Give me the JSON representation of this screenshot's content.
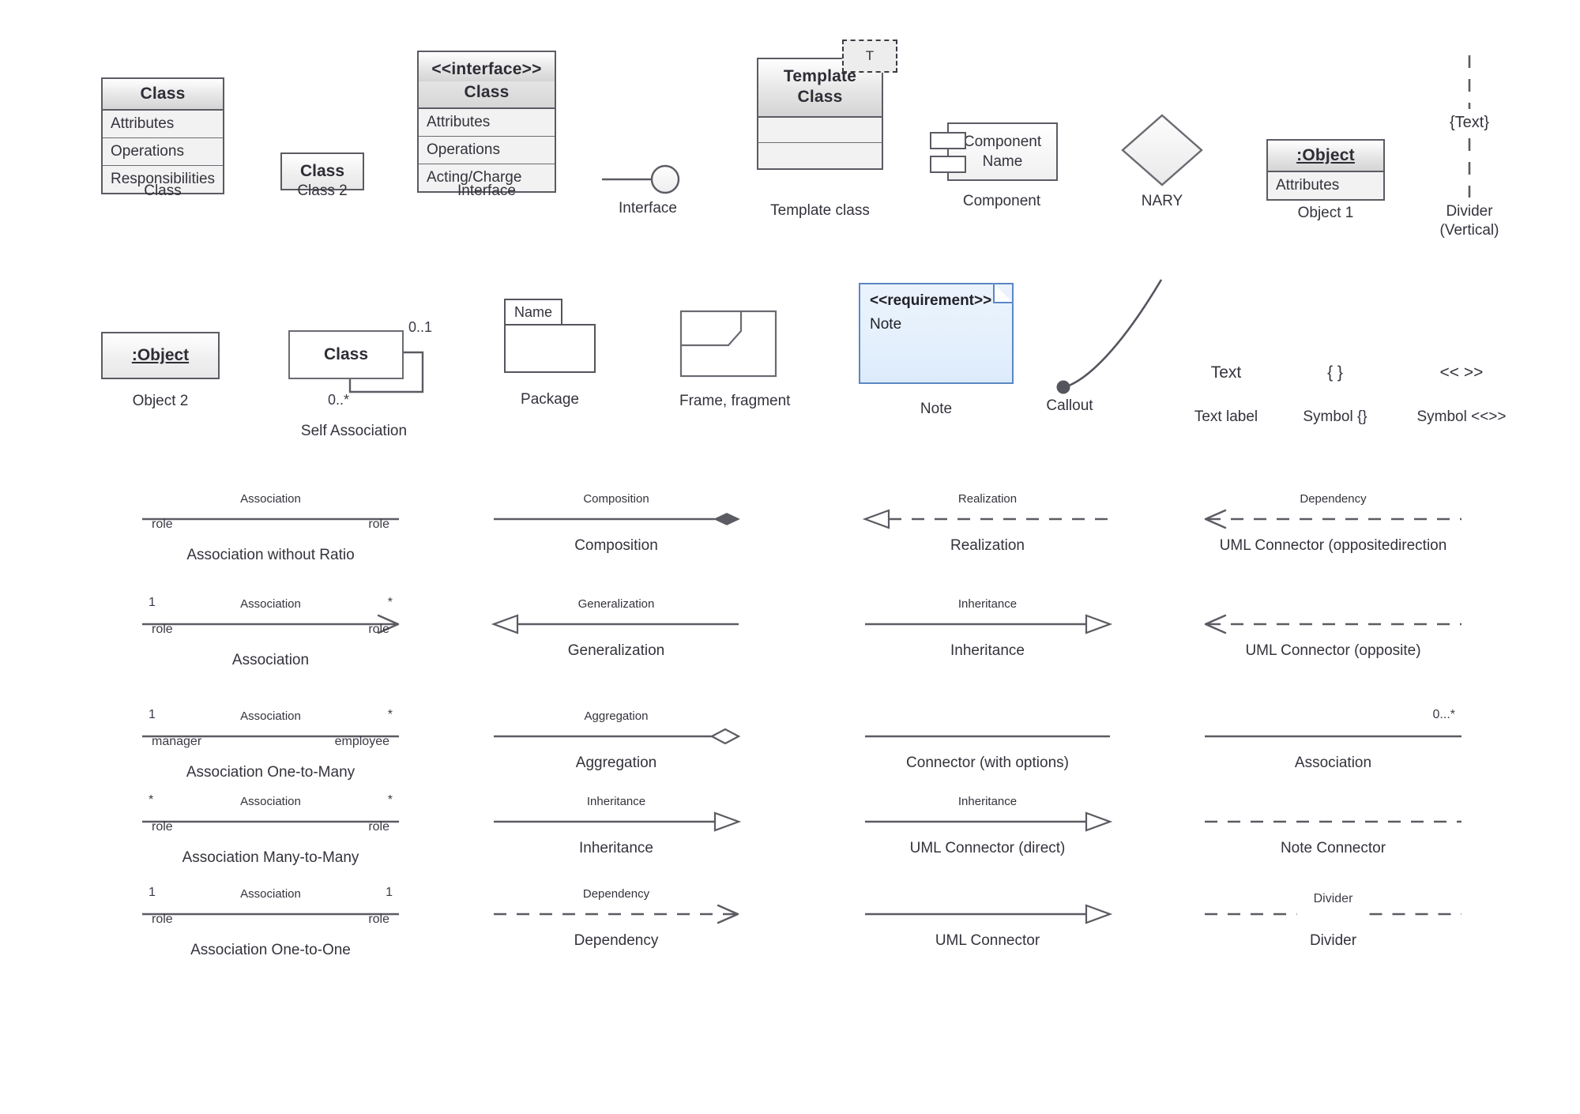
{
  "palette": {
    "stroke": "#5b5b63",
    "text": "#33333c",
    "note_border": "#5b87c6",
    "note_fill": "#e4f0fc",
    "header_gradient_top": "#ffffff",
    "header_gradient_bottom": "#d4d4d4",
    "body_fill": "#f2f2f2",
    "background": "#ffffff"
  },
  "shapes_row1": {
    "class_full": {
      "caption": "Class",
      "header": "Class",
      "rows": [
        "Attributes",
        "Operations",
        "Responsibilities"
      ]
    },
    "class2": {
      "caption": "Class 2",
      "label": "Class"
    },
    "interface_box": {
      "caption": "Interface",
      "stereotype": "<<interface>>",
      "header": "Class",
      "rows": [
        "Attributes",
        "Operations",
        "Acting/Charge"
      ]
    },
    "interface_lollipop": {
      "caption": "Interface"
    },
    "template_class": {
      "caption": "Template class",
      "header": "Template\nClass",
      "parameter": "T",
      "rows": [
        "",
        ""
      ]
    },
    "component": {
      "caption": "Component",
      "label": "Component\nName"
    },
    "nary": {
      "caption": "NARY"
    },
    "object1": {
      "caption": "Object 1",
      "header": ":Object",
      "rows": [
        "Attributes"
      ]
    },
    "divider_vertical": {
      "caption": "Divider\n(Vertical)",
      "label": "{Text}"
    }
  },
  "shapes_row2": {
    "object2": {
      "caption": "Object 2",
      "label": ":Object"
    },
    "self_association": {
      "caption": "Self Association",
      "label": "Class",
      "mult_top": "0..1",
      "mult_bottom": "0..*"
    },
    "package": {
      "caption": "Package",
      "tab_label": "Name"
    },
    "frame_fragment": {
      "caption": "Frame, fragment"
    },
    "note": {
      "caption": "Note",
      "stereotype": "<<requirement>>",
      "body": "Note"
    },
    "callout": {
      "caption": "Callout"
    },
    "text_label": {
      "caption": "Text label",
      "sample": "Text"
    },
    "symbol_braces": {
      "caption": "Symbol {}",
      "sample": "{ }"
    },
    "symbol_guillemets": {
      "caption": "Symbol <<>>",
      "sample": "<< >>"
    }
  },
  "connectors": [
    {
      "caption": "Association without Ratio",
      "edge_label": "Association",
      "mult_left": "",
      "mult_right": "",
      "role_left": "role",
      "role_right": "role",
      "style": "solid",
      "arrow": "none",
      "col": 0,
      "row": 0
    },
    {
      "caption": "Composition",
      "edge_label": "Composition",
      "mult_left": "",
      "mult_right": "",
      "role_left": "",
      "role_right": "",
      "style": "solid",
      "arrow": "filled-diamond-right",
      "col": 1,
      "row": 0
    },
    {
      "caption": "Realization",
      "edge_label": "Realization",
      "mult_left": "",
      "mult_right": "",
      "role_left": "",
      "role_right": "",
      "style": "dashed",
      "arrow": "hollow-triangle-left",
      "col": 2,
      "row": 0
    },
    {
      "caption": "UML Connector (oppositedirection",
      "edge_label": "Dependency",
      "mult_left": "",
      "mult_right": "",
      "role_left": "",
      "role_right": "",
      "style": "dashed",
      "arrow": "open-left",
      "col": 3,
      "row": 0
    },
    {
      "caption": "Association",
      "edge_label": "Association",
      "mult_left": "1",
      "mult_right": "*",
      "role_left": "role",
      "role_right": "role",
      "style": "solid",
      "arrow": "open-right",
      "col": 0,
      "row": 1
    },
    {
      "caption": "Generalization",
      "edge_label": "Generalization",
      "mult_left": "",
      "mult_right": "",
      "role_left": "",
      "role_right": "",
      "style": "solid",
      "arrow": "hollow-triangle-left",
      "col": 1,
      "row": 1
    },
    {
      "caption": "Inheritance",
      "edge_label": "Inheritance",
      "mult_left": "",
      "mult_right": "",
      "role_left": "",
      "role_right": "",
      "style": "solid",
      "arrow": "hollow-triangle-right",
      "col": 2,
      "row": 1
    },
    {
      "caption": "UML Connector (opposite)",
      "edge_label": "",
      "mult_left": "",
      "mult_right": "",
      "role_left": "",
      "role_right": "",
      "style": "dashed",
      "arrow": "open-left",
      "col": 3,
      "row": 1
    },
    {
      "caption": "Association One-to-Many",
      "edge_label": "Association",
      "mult_left": "1",
      "mult_right": "*",
      "role_left": "manager",
      "role_right": "employee",
      "style": "solid",
      "arrow": "none",
      "col": 0,
      "row": 2
    },
    {
      "caption": "Aggregation",
      "edge_label": "Aggregation",
      "mult_left": "",
      "mult_right": "",
      "role_left": "",
      "role_right": "",
      "style": "solid",
      "arrow": "hollow-diamond-right",
      "col": 1,
      "row": 2
    },
    {
      "caption": "Connector (with options)",
      "edge_label": "",
      "mult_left": "",
      "mult_right": "",
      "role_left": "",
      "role_right": "",
      "style": "solid",
      "arrow": "none",
      "col": 2,
      "row": 2
    },
    {
      "caption": "Association",
      "edge_label": "",
      "mult_left": "",
      "mult_right": "0...*",
      "role_left": "",
      "role_right": "",
      "style": "solid",
      "arrow": "none",
      "col": 3,
      "row": 2
    },
    {
      "caption": "Association Many-to-Many",
      "edge_label": "Association",
      "mult_left": "*",
      "mult_right": "*",
      "role_left": "role",
      "role_right": "role",
      "style": "solid",
      "arrow": "none",
      "col": 0,
      "row": 3
    },
    {
      "caption": "Inheritance",
      "edge_label": "Inheritance",
      "mult_left": "",
      "mult_right": "",
      "role_left": "",
      "role_right": "",
      "style": "solid",
      "arrow": "hollow-triangle-right",
      "col": 1,
      "row": 3
    },
    {
      "caption": "UML Connector (direct)",
      "edge_label": "Inheritance",
      "mult_left": "",
      "mult_right": "",
      "role_left": "",
      "role_right": "",
      "style": "solid",
      "arrow": "hollow-triangle-right",
      "col": 2,
      "row": 3
    },
    {
      "caption": "Note Connector",
      "edge_label": "",
      "mult_left": "",
      "mult_right": "",
      "role_left": "",
      "role_right": "",
      "style": "dashed",
      "arrow": "none",
      "col": 3,
      "row": 3
    },
    {
      "caption": "Association One-to-One",
      "edge_label": "Association",
      "mult_left": "1",
      "mult_right": "1",
      "role_left": "role",
      "role_right": "role",
      "style": "solid",
      "arrow": "none",
      "col": 0,
      "row": 4
    },
    {
      "caption": "Dependency",
      "edge_label": "Dependency",
      "mult_left": "",
      "mult_right": "",
      "role_left": "",
      "role_right": "",
      "style": "dashed",
      "arrow": "open-right",
      "col": 1,
      "row": 4
    },
    {
      "caption": "UML Connector",
      "edge_label": "",
      "mult_left": "",
      "mult_right": "",
      "role_left": "",
      "role_right": "",
      "style": "solid",
      "arrow": "hollow-triangle-right",
      "col": 2,
      "row": 4
    },
    {
      "caption": "Divider",
      "edge_label": "",
      "divider_label": "Divider",
      "mult_left": "",
      "mult_right": "",
      "role_left": "",
      "role_right": "",
      "style": "dashed",
      "arrow": "none",
      "col": 3,
      "row": 4
    }
  ]
}
